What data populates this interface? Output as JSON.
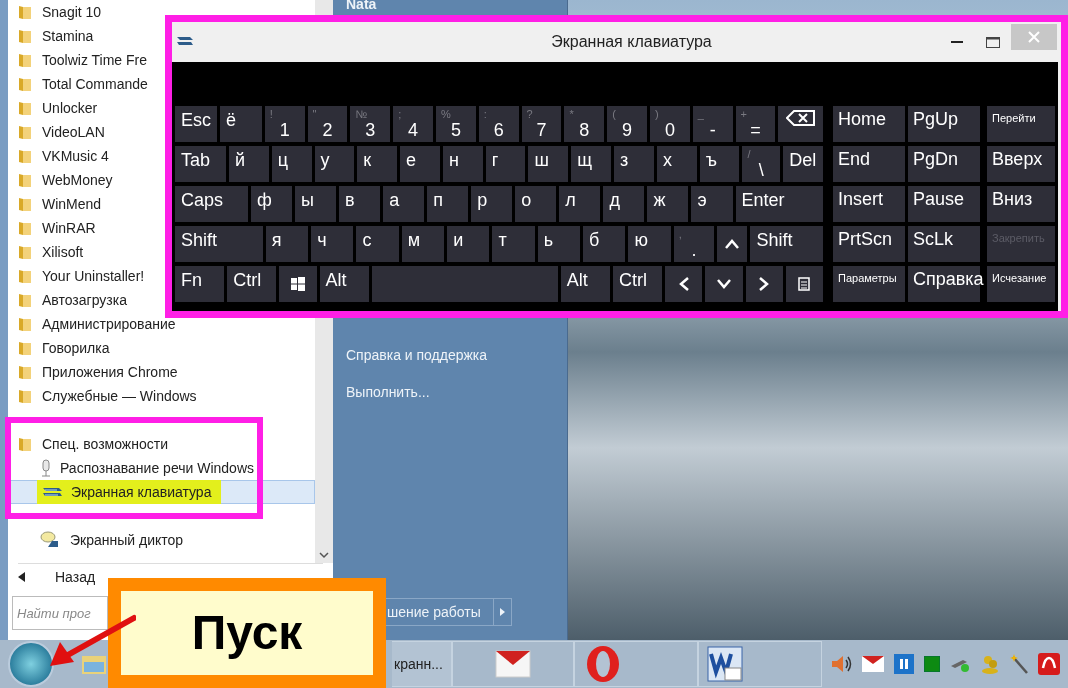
{
  "start_menu": {
    "programs": [
      {
        "name": "Snagit 10"
      },
      {
        "name": "Stamina"
      },
      {
        "name": "Toolwiz Time Fre"
      },
      {
        "name": "Total Commande"
      },
      {
        "name": "Unlocker"
      },
      {
        "name": "VideoLAN"
      },
      {
        "name": "VKMusic 4"
      },
      {
        "name": "WebMoney"
      },
      {
        "name": "WinMend"
      },
      {
        "name": "WinRAR"
      },
      {
        "name": "Xilisoft"
      },
      {
        "name": "Your Uninstaller!"
      },
      {
        "name": "Автозагрузка"
      },
      {
        "name": "Администрирование"
      },
      {
        "name": "Говорилка"
      },
      {
        "name": "Приложения Chrome"
      },
      {
        "name": "Служебные — Windows"
      }
    ],
    "expanded_folder": {
      "name": "Спец. возможности",
      "children": [
        {
          "name": "Распознавание речи Windows",
          "kind": "mic",
          "selected": false
        },
        {
          "name": "Экранная клавиатура",
          "kind": "keyboard",
          "selected": true
        },
        {
          "name": "Экранный диктор",
          "kind": "narrator",
          "selected": false
        }
      ]
    },
    "back": "Назад",
    "search": {
      "placeholder": "Найти прог"
    },
    "user": "Nata",
    "links": [
      "Справка и поддержка",
      "Выполнить..."
    ],
    "shutdown": "шение работы"
  },
  "keyboard_window": {
    "title": "Экранная клавиатура",
    "rows": [
      {
        "keys": [
          {
            "label": "Esc",
            "kind": "mod"
          },
          {
            "label": "ё",
            "kind": "letter"
          },
          {
            "alt": "!",
            "label": "1",
            "kind": "num"
          },
          {
            "alt": "\"",
            "label": "2",
            "kind": "num"
          },
          {
            "alt": "№",
            "label": "3",
            "kind": "num"
          },
          {
            "alt": ";",
            "label": "4",
            "kind": "num"
          },
          {
            "alt": "%",
            "label": "5",
            "kind": "num"
          },
          {
            "alt": ":",
            "label": "6",
            "kind": "num"
          },
          {
            "alt": "?",
            "label": "7",
            "kind": "num"
          },
          {
            "alt": "*",
            "label": "8",
            "kind": "num"
          },
          {
            "alt": "(",
            "label": "9",
            "kind": "num"
          },
          {
            "alt": ")",
            "label": "0",
            "kind": "num"
          },
          {
            "alt": "_",
            "label": "-",
            "kind": "num"
          },
          {
            "alt": "+",
            "label": "=",
            "kind": "num"
          },
          {
            "kind": "backspace"
          }
        ]
      },
      {
        "keys": [
          {
            "label": "Tab",
            "kind": "tab"
          },
          {
            "label": "й",
            "kind": "letter"
          },
          {
            "label": "ц",
            "kind": "letter"
          },
          {
            "label": "у",
            "kind": "letter"
          },
          {
            "label": "к",
            "kind": "letter"
          },
          {
            "label": "е",
            "kind": "letter"
          },
          {
            "label": "н",
            "kind": "letter"
          },
          {
            "label": "г",
            "kind": "letter"
          },
          {
            "label": "ш",
            "kind": "letter"
          },
          {
            "label": "щ",
            "kind": "letter"
          },
          {
            "label": "з",
            "kind": "letter"
          },
          {
            "label": "х",
            "kind": "letter"
          },
          {
            "label": "ъ",
            "kind": "letter"
          },
          {
            "alt": "/",
            "label": "\\",
            "kind": "num"
          },
          {
            "label": "Del",
            "kind": "mod"
          }
        ]
      },
      {
        "keys": [
          {
            "label": "Caps",
            "kind": "caps"
          },
          {
            "label": "ф",
            "kind": "letter"
          },
          {
            "label": "ы",
            "kind": "letter"
          },
          {
            "label": "в",
            "kind": "letter"
          },
          {
            "label": "а",
            "kind": "letter"
          },
          {
            "label": "п",
            "kind": "letter"
          },
          {
            "label": "р",
            "kind": "letter"
          },
          {
            "label": "о",
            "kind": "letter"
          },
          {
            "label": "л",
            "kind": "letter"
          },
          {
            "label": "д",
            "kind": "letter"
          },
          {
            "label": "ж",
            "kind": "letter"
          },
          {
            "label": "э",
            "kind": "letter"
          },
          {
            "label": "Enter",
            "kind": "enter"
          }
        ]
      },
      {
        "keys": [
          {
            "label": "Shift",
            "kind": "lshift"
          },
          {
            "label": "я",
            "kind": "letter"
          },
          {
            "label": "ч",
            "kind": "letter"
          },
          {
            "label": "с",
            "kind": "letter"
          },
          {
            "label": "м",
            "kind": "letter"
          },
          {
            "label": "и",
            "kind": "letter"
          },
          {
            "label": "т",
            "kind": "letter"
          },
          {
            "label": "ь",
            "kind": "letter"
          },
          {
            "label": "б",
            "kind": "letter"
          },
          {
            "label": "ю",
            "kind": "letter"
          },
          {
            "alt": ",",
            "label": ".",
            "kind": "num"
          },
          {
            "kind": "up"
          },
          {
            "label": "Shift",
            "kind": "rshift"
          }
        ]
      },
      {
        "keys": [
          {
            "label": "Fn",
            "kind": "mod"
          },
          {
            "label": "Ctrl",
            "kind": "mod"
          },
          {
            "kind": "win"
          },
          {
            "label": "Alt",
            "kind": "mod"
          },
          {
            "kind": "space"
          },
          {
            "label": "Alt",
            "kind": "mod"
          },
          {
            "label": "Ctrl",
            "kind": "mod"
          },
          {
            "kind": "left"
          },
          {
            "kind": "down"
          },
          {
            "kind": "right"
          },
          {
            "kind": "menu"
          }
        ]
      }
    ],
    "nav": [
      [
        {
          "label": "Home",
          "kind": "key",
          "disabled": false
        },
        {
          "label": "PgUp",
          "kind": "key",
          "disabled": false
        },
        {
          "label": "Перейти",
          "kind": "small",
          "disabled": false
        }
      ],
      [
        {
          "label": "End",
          "kind": "key",
          "disabled": false
        },
        {
          "label": "PgDn",
          "kind": "key",
          "disabled": false
        },
        {
          "label": "Вверх",
          "kind": "key",
          "disabled": false
        }
      ],
      [
        {
          "label": "Insert",
          "kind": "key",
          "disabled": false
        },
        {
          "label": "Pause",
          "kind": "key",
          "disabled": false
        },
        {
          "label": "Вниз",
          "kind": "key",
          "disabled": false
        }
      ],
      [
        {
          "label": "PrtScn",
          "kind": "key",
          "disabled": false
        },
        {
          "label": "ScLk",
          "kind": "key",
          "disabled": false
        },
        {
          "label": "Закрепить",
          "kind": "small",
          "disabled": true
        }
      ],
      [
        {
          "label": "Параметры",
          "kind": "small",
          "disabled": false
        },
        {
          "label": "Справка",
          "kind": "key",
          "disabled": false
        },
        {
          "label": "Исчезание",
          "kind": "small",
          "disabled": false
        }
      ]
    ]
  },
  "taskbar": {
    "task_label": "кранн..."
  },
  "callout": {
    "text": "Пуск"
  }
}
